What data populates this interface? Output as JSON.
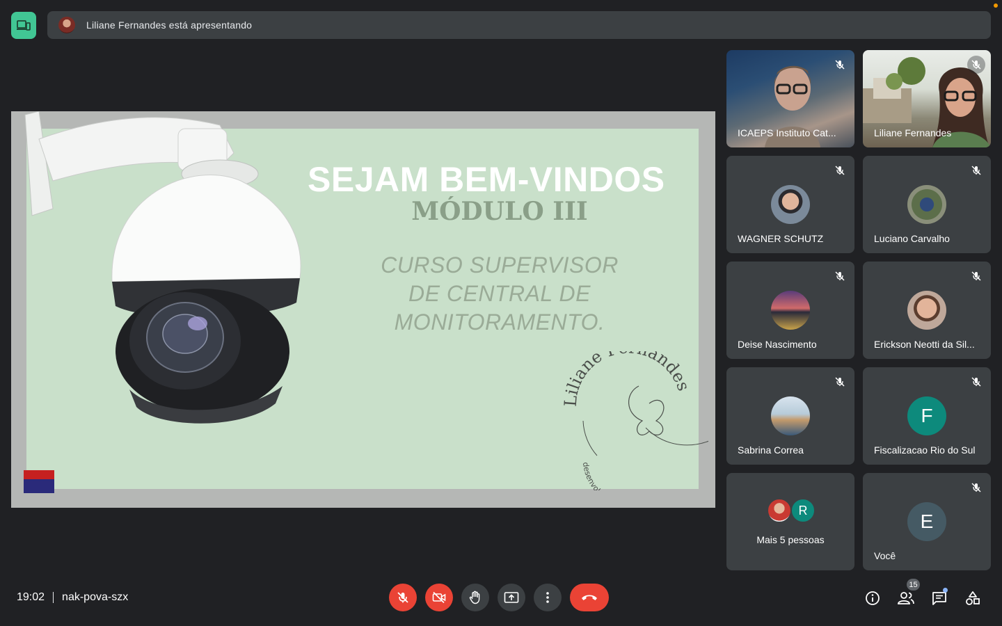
{
  "top_bar": {
    "presenting_text": "Liliane Fernandes está apresentando"
  },
  "slide": {
    "title": "SEJAM BEM-VINDOS",
    "subtitle": "MÓDULO III",
    "course_lines": [
      "CURSO SUPERVISOR",
      "DE CENTRAL DE",
      "MONITORAMENTO."
    ],
    "logo_name": "Liliane Fernandes",
    "logo_tagline": "desenvolvimento humano"
  },
  "participants": [
    {
      "name": "ICAEPS Instituto Cat...",
      "type": "video",
      "muted": true
    },
    {
      "name": "Liliane Fernandes",
      "type": "video",
      "muted": true
    },
    {
      "name": "WAGNER SCHUTZ",
      "type": "photo",
      "muted": true
    },
    {
      "name": "Luciano Carvalho",
      "type": "photo",
      "muted": true
    },
    {
      "name": "Deise Nascimento",
      "type": "photo",
      "muted": true
    },
    {
      "name": "Erickson Neotti da Sil...",
      "type": "photo",
      "muted": true
    },
    {
      "name": "Sabrina Correa",
      "type": "photo",
      "muted": true
    },
    {
      "name": "Fiscalizacao Rio do Sul",
      "type": "letter",
      "letter": "F",
      "color": "#0d8a7c",
      "muted": true
    },
    {
      "name": "Mais 5 pessoas",
      "type": "more",
      "letter": "R",
      "color": "#0d8a7c"
    },
    {
      "name": "Você",
      "type": "letter",
      "letter": "E",
      "color": "#455a64",
      "muted": true
    }
  ],
  "bottom_bar": {
    "time": "19:02",
    "meeting_code": "nak-pova-szx",
    "participant_count": "15"
  },
  "colors": {
    "background": "#202124",
    "tile": "#3c4043",
    "danger": "#ea4335",
    "accent": "#41c694",
    "slide_bg": "#c9e0ca"
  }
}
